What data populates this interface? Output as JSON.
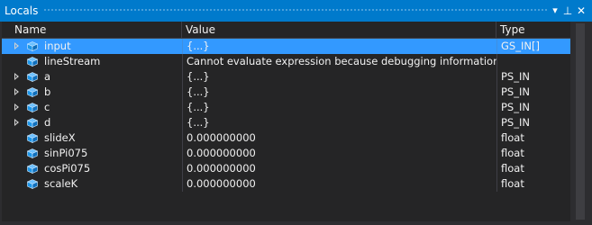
{
  "window": {
    "title": "Locals",
    "dropdown_glyph": "▾",
    "pin_glyph": "⊥",
    "close_glyph": "✕"
  },
  "columns": {
    "name": "Name",
    "value": "Value",
    "type": "Type"
  },
  "rows": [
    {
      "name": "input",
      "value": "{...}",
      "type": "GS_IN[]",
      "expandable": true,
      "selected": true
    },
    {
      "name": "lineStream",
      "value": "Cannot evaluate expression because debugging information has b",
      "type": "",
      "expandable": false,
      "selected": false
    },
    {
      "name": "a",
      "value": "{...}",
      "type": "PS_IN",
      "expandable": true,
      "selected": false
    },
    {
      "name": "b",
      "value": "{...}",
      "type": "PS_IN",
      "expandable": true,
      "selected": false
    },
    {
      "name": "c",
      "value": "{...}",
      "type": "PS_IN",
      "expandable": true,
      "selected": false
    },
    {
      "name": "d",
      "value": "{...}",
      "type": "PS_IN",
      "expandable": true,
      "selected": false
    },
    {
      "name": "slideX",
      "value": "0.000000000",
      "type": "float",
      "expandable": false,
      "selected": false
    },
    {
      "name": "sinPi075",
      "value": "0.000000000",
      "type": "float",
      "expandable": false,
      "selected": false
    },
    {
      "name": "cosPi075",
      "value": "0.000000000",
      "type": "float",
      "expandable": false,
      "selected": false
    },
    {
      "name": "scaleK",
      "value": "0.000000000",
      "type": "float",
      "expandable": false,
      "selected": false
    }
  ],
  "icons": {
    "expander": "expand-triangle-icon",
    "variable": "local-variable-cube-icon"
  },
  "colors": {
    "accent": "#007acc",
    "selection": "#3399ff",
    "background": "#252526",
    "icon_blue": "#1c97ea"
  }
}
